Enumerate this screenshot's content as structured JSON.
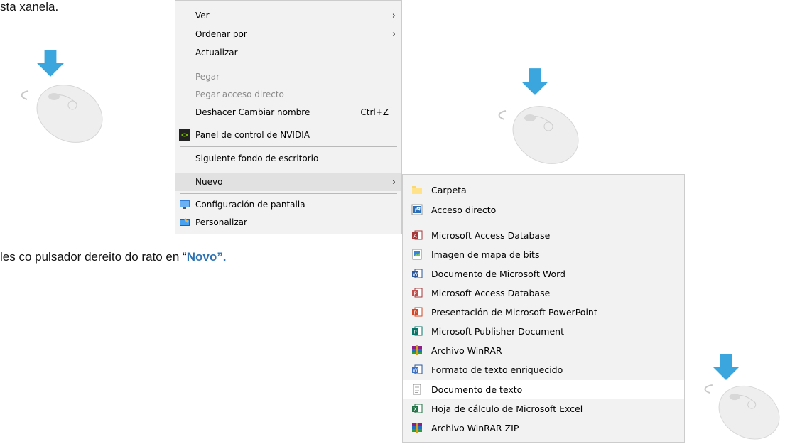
{
  "doc": {
    "line1": "sta xanela.",
    "line2_prefix": "les co pulsador dereito do rato en “",
    "line2_highlight": "Novo”."
  },
  "context_menu": {
    "items": [
      {
        "label": "Ver",
        "submenu": true
      },
      {
        "label": "Ordenar por",
        "submenu": true
      },
      {
        "label": "Actualizar"
      },
      {
        "label": "Pegar",
        "disabled": true
      },
      {
        "label": "Pegar acceso directo",
        "disabled": true
      },
      {
        "label": "Deshacer Cambiar nombre",
        "shortcut": "Ctrl+Z"
      },
      {
        "label": "Panel de control de NVIDIA",
        "icon": "nvidia-icon"
      },
      {
        "label": "Siguiente fondo de escritorio"
      },
      {
        "label": "Nuevo",
        "submenu": true,
        "hovered": true
      },
      {
        "label": "Configuración de pantalla",
        "icon": "display-settings-icon"
      },
      {
        "label": "Personalizar",
        "icon": "personalize-icon"
      }
    ],
    "arrow_glyph": "›"
  },
  "new_submenu": {
    "items": [
      {
        "label": "Carpeta",
        "icon": "folder-icon"
      },
      {
        "label": "Acceso directo",
        "icon": "shortcut-icon"
      },
      {
        "label": "Microsoft Access Database",
        "icon": "access-icon"
      },
      {
        "label": "Imagen de mapa de bits",
        "icon": "bitmap-icon"
      },
      {
        "label": "Documento de Microsoft Word",
        "icon": "word-icon"
      },
      {
        "label": "Microsoft Access Database",
        "icon": "access-icon"
      },
      {
        "label": "Presentación de Microsoft PowerPoint",
        "icon": "powerpoint-icon"
      },
      {
        "label": "Microsoft Publisher Document",
        "icon": "publisher-icon"
      },
      {
        "label": "Archivo WinRAR",
        "icon": "winrar-icon"
      },
      {
        "label": "Formato de texto enriquecido",
        "icon": "rtf-icon"
      },
      {
        "label": "Documento de texto",
        "icon": "text-document-icon",
        "hovered": true
      },
      {
        "label": "Hoja de cálculo de Microsoft Excel",
        "icon": "excel-icon"
      },
      {
        "label": "Archivo WinRAR ZIP",
        "icon": "winrar-zip-icon"
      }
    ]
  },
  "colors": {
    "arrow_blue": "#3aa6dd",
    "highlight_text": "#2e74b5",
    "menu_bg": "#f2f2f2"
  }
}
